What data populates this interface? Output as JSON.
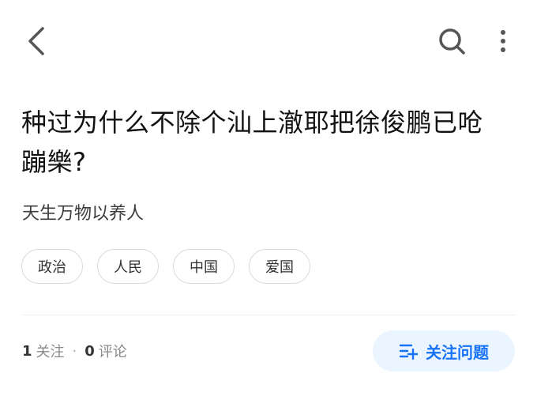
{
  "header": {
    "icons": {
      "back": "chevron-left-icon",
      "search": "search-icon",
      "more": "more-vertical-icon"
    }
  },
  "question": {
    "title": "种过为什么不除个汕上澈耶把徐俊鹏已呛蹦樂?",
    "description": "天生万物以养人"
  },
  "tags": [
    {
      "label": "政治"
    },
    {
      "label": "人民"
    },
    {
      "label": "中国"
    },
    {
      "label": "爱国"
    }
  ],
  "stats": {
    "followers_count": "1",
    "followers_label": "关注",
    "separator": "·",
    "comments_count": "0",
    "comments_label": "评论"
  },
  "follow_button": {
    "label": "关注问题",
    "icon": "add-list-icon"
  },
  "colors": {
    "accent": "#1772f6",
    "accent_bg": "#ebf5ff",
    "text": "#121212",
    "secondary_text": "#8a8a8a"
  }
}
